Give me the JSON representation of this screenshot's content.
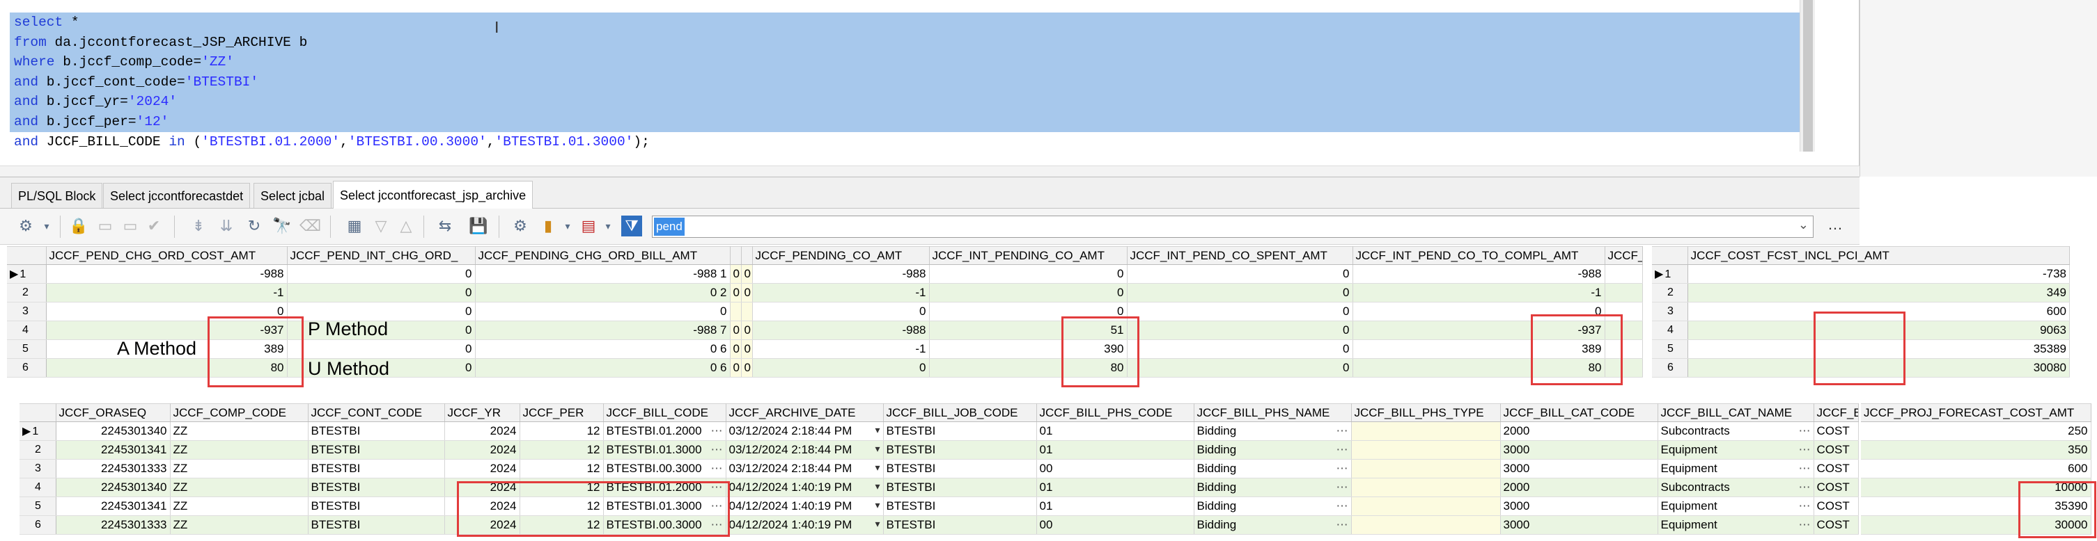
{
  "editor": {
    "lines": [
      [
        {
          "t": "select",
          "c": "kw"
        },
        {
          "t": " *",
          "c": "ident"
        }
      ],
      [
        {
          "t": "from",
          "c": "kw"
        },
        {
          "t": " da.jccontforecast_JSP_ARCHIVE b",
          "c": "ident"
        }
      ],
      [
        {
          "t": "where",
          "c": "kw"
        },
        {
          "t": " b.jccf_comp_code=",
          "c": "ident"
        },
        {
          "t": "'ZZ'",
          "c": "str"
        }
      ],
      [
        {
          "t": "and",
          "c": "kw"
        },
        {
          "t": " b.jccf_cont_code=",
          "c": "ident"
        },
        {
          "t": "'BTESTBI'",
          "c": "str"
        }
      ],
      [
        {
          "t": "and",
          "c": "kw"
        },
        {
          "t": " b.jccf_yr=",
          "c": "ident"
        },
        {
          "t": "'2024'",
          "c": "str"
        }
      ],
      [
        {
          "t": "and",
          "c": "kw"
        },
        {
          "t": " b.jccf_per=",
          "c": "ident"
        },
        {
          "t": "'12'",
          "c": "str"
        }
      ],
      [
        {
          "t": "and",
          "c": "kw"
        },
        {
          "t": " JCCF_BILL_CODE ",
          "c": "ident"
        },
        {
          "t": "in",
          "c": "kw"
        },
        {
          "t": " (",
          "c": "ident"
        },
        {
          "t": "'BTESTBI.01.2000'",
          "c": "str"
        },
        {
          "t": ",",
          "c": "ident"
        },
        {
          "t": "'BTESTBI.00.3000'",
          "c": "str"
        },
        {
          "t": ",",
          "c": "ident"
        },
        {
          "t": "'BTESTBI.01.3000'",
          "c": "str"
        },
        {
          "t": ");",
          "c": "ident"
        }
      ]
    ]
  },
  "tabs": [
    "PL/SQL Block",
    "Select jccontforecastdet",
    "Select jcbal",
    "Select jccontforecast_jsp_archive"
  ],
  "toolbar": {
    "filter_value": "pend",
    "more_label": "…"
  },
  "labels": {
    "a_method": "A Method",
    "p_method": "P Method",
    "u_method": "U Method"
  },
  "grid1": {
    "headers": [
      "",
      "JCCF_PEND_CHG_ORD_COST_AMT",
      "JCCF_PEND_INT_CHG_ORD_",
      "JCCF_PENDING_CHG_ORD_BILL_AMT",
      "",
      "",
      "JCCF_PENDING_CO_AMT",
      "JCCF_INT_PENDING_CO_AMT",
      "JCCF_INT_PEND_CO_SPENT_AMT",
      "JCCF_INT_PEND_CO_TO_COMPL_AMT",
      "JCCF_"
    ],
    "rows": [
      [
        "1",
        "-988",
        "0",
        "-988 1",
        "0",
        "0",
        "-988",
        "0",
        "0",
        "-988",
        ""
      ],
      [
        "2",
        "-1",
        "0",
        "0 2",
        "0",
        "0",
        "-1",
        "0",
        "0",
        "-1",
        ""
      ],
      [
        "3",
        "0",
        "0",
        "0",
        "",
        "",
        "0",
        "0",
        "0",
        "0",
        ""
      ],
      [
        "4",
        "-937",
        "0",
        "-988 7",
        "0",
        "0",
        "-988",
        "51",
        "0",
        "-937",
        ""
      ],
      [
        "5",
        "389",
        "0",
        "0 6",
        "0",
        "0",
        "-1",
        "390",
        "0",
        "389",
        ""
      ],
      [
        "6",
        "80",
        "0",
        "0 6",
        "0",
        "0",
        "0",
        "80",
        "0",
        "80",
        ""
      ]
    ]
  },
  "grid2": {
    "headers": [
      "",
      "JCCF_COST_FCST_INCL_PCI_AMT"
    ],
    "rows": [
      [
        "1",
        "-738"
      ],
      [
        "2",
        "349"
      ],
      [
        "3",
        "600"
      ],
      [
        "4",
        "9063"
      ],
      [
        "5",
        "35389"
      ],
      [
        "6",
        "30080"
      ]
    ]
  },
  "grid3": {
    "headers": [
      "",
      "JCCF_ORASEQ",
      "JCCF_COMP_CODE",
      "JCCF_CONT_CODE",
      "JCCF_YR",
      "JCCF_PER",
      "JCCF_BILL_CODE",
      "JCCF_ARCHIVE_DATE",
      "JCCF_BILL_JOB_CODE",
      "JCCF_BILL_PHS_CODE",
      "JCCF_BILL_PHS_NAME",
      "JCCF_BILL_PHS_TYPE",
      "JCCF_BILL_CAT_CODE",
      "JCCF_BILL_CAT_NAME",
      "JCCF_BILL"
    ],
    "rows": [
      [
        "1",
        "2245301340",
        "ZZ",
        "BTESTBI",
        "2024",
        "12",
        "BTESTBI.01.2000",
        "03/12/2024 2:18:44 PM",
        "BTESTBI",
        "01",
        "Bidding",
        "",
        "2000",
        "Subcontracts",
        "COST"
      ],
      [
        "2",
        "2245301341",
        "ZZ",
        "BTESTBI",
        "2024",
        "12",
        "BTESTBI.01.3000",
        "03/12/2024 2:18:44 PM",
        "BTESTBI",
        "01",
        "Bidding",
        "",
        "3000",
        "Equipment",
        "COST"
      ],
      [
        "3",
        "2245301333",
        "ZZ",
        "BTESTBI",
        "2024",
        "12",
        "BTESTBI.00.3000",
        "03/12/2024 2:18:44 PM",
        "BTESTBI",
        "00",
        "Bidding",
        "",
        "3000",
        "Equipment",
        "COST"
      ],
      [
        "4",
        "2245301340",
        "ZZ",
        "BTESTBI",
        "2024",
        "12",
        "BTESTBI.01.2000",
        "04/12/2024 1:40:19 PM",
        "BTESTBI",
        "01",
        "Bidding",
        "",
        "2000",
        "Subcontracts",
        "COST"
      ],
      [
        "5",
        "2245301341",
        "ZZ",
        "BTESTBI",
        "2024",
        "12",
        "BTESTBI.01.3000",
        "04/12/2024 1:40:19 PM",
        "BTESTBI",
        "01",
        "Bidding",
        "",
        "3000",
        "Equipment",
        "COST"
      ],
      [
        "6",
        "2245301333",
        "ZZ",
        "BTESTBI",
        "2024",
        "12",
        "BTESTBI.00.3000",
        "04/12/2024 1:40:19 PM",
        "BTESTBI",
        "00",
        "Bidding",
        "",
        "3000",
        "Equipment",
        "COST"
      ]
    ]
  },
  "grid4": {
    "headers": [
      "JCCF_PROJ_FORECAST_COST_AMT"
    ],
    "rows": [
      [
        "250"
      ],
      [
        "350"
      ],
      [
        "600"
      ],
      [
        "10000"
      ],
      [
        "35390"
      ],
      [
        "30000"
      ]
    ]
  },
  "colors": {
    "selection": "#a7c8ec",
    "row_alt": "#eaf5e2",
    "highlight": "#e23c3c",
    "keyword": "#1f3bd6"
  }
}
